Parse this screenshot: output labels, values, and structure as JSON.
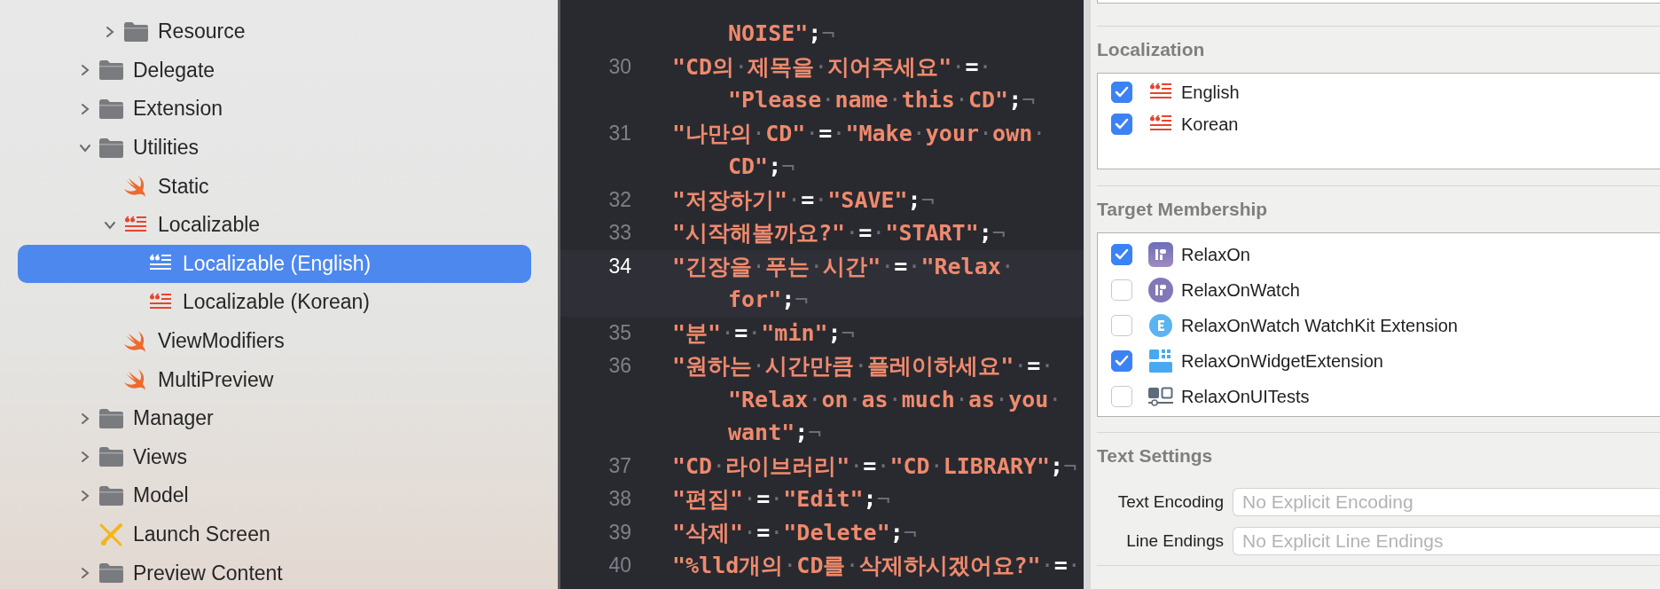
{
  "navigator": {
    "items": [
      {
        "children": [
          {
            "name": "Resource",
            "kind": "folder",
            "expanded": false
          }
        ]
      },
      {
        "name": "Delegate",
        "kind": "folder",
        "expanded": false
      },
      {
        "name": "Extension",
        "kind": "folder",
        "expanded": false
      },
      {
        "name": "Utilities",
        "kind": "folder",
        "expanded": true,
        "children": [
          {
            "name": "Static",
            "kind": "swift"
          },
          {
            "name": "Localizable",
            "kind": "strings",
            "expanded": true,
            "children": [
              {
                "name": "Localizable (English)",
                "kind": "strings",
                "selected": true
              },
              {
                "name": "Localizable (Korean)",
                "kind": "strings",
                "selected": false
              }
            ]
          },
          {
            "name": "ViewModifiers",
            "kind": "swift"
          },
          {
            "name": "MultiPreview",
            "kind": "swift"
          }
        ]
      },
      {
        "name": "Manager",
        "kind": "folder",
        "expanded": false
      },
      {
        "name": "Views",
        "kind": "folder",
        "expanded": false
      },
      {
        "name": "Model",
        "kind": "folder",
        "expanded": false
      },
      {
        "name": "Launch Screen",
        "kind": "storyboard"
      },
      {
        "name": "Preview Content",
        "kind": "folder",
        "expanded": false
      }
    ]
  },
  "editor": {
    "lines": [
      {
        "continuation": true,
        "current": false,
        "rows": [
          {
            "tokens": [
              {
                "kind": "string",
                "text": "NOISE\""
              },
              {
                "kind": "op",
                "text": ";"
              },
              {
                "kind": "eol",
                "text": "¬"
              }
            ]
          }
        ]
      },
      {
        "number": "30",
        "current": false,
        "rows": [
          {
            "tokens": [
              {
                "kind": "string",
                "text": "\"CD의"
              },
              {
                "kind": "space",
                "text": "·"
              },
              {
                "kind": "string",
                "text": "제목을"
              },
              {
                "kind": "space",
                "text": "·"
              },
              {
                "kind": "string",
                "text": "지어주세요\""
              },
              {
                "kind": "space",
                "text": "·"
              },
              {
                "kind": "op",
                "text": "="
              },
              {
                "kind": "space",
                "text": "·"
              }
            ]
          },
          {
            "tokens": [
              {
                "kind": "string",
                "text": "\"Please"
              },
              {
                "kind": "space",
                "text": "·"
              },
              {
                "kind": "string",
                "text": "name"
              },
              {
                "kind": "space",
                "text": "·"
              },
              {
                "kind": "string",
                "text": "this"
              },
              {
                "kind": "space",
                "text": "·"
              },
              {
                "kind": "string",
                "text": "CD\""
              },
              {
                "kind": "op",
                "text": ";"
              },
              {
                "kind": "eol",
                "text": "¬"
              }
            ]
          }
        ]
      },
      {
        "number": "31",
        "current": false,
        "rows": [
          {
            "tokens": [
              {
                "kind": "string",
                "text": "\"나만의"
              },
              {
                "kind": "space",
                "text": "·"
              },
              {
                "kind": "string",
                "text": "CD\""
              },
              {
                "kind": "space",
                "text": "·"
              },
              {
                "kind": "op",
                "text": "="
              },
              {
                "kind": "space",
                "text": "·"
              },
              {
                "kind": "string",
                "text": "\"Make"
              },
              {
                "kind": "space",
                "text": "·"
              },
              {
                "kind": "string",
                "text": "your"
              },
              {
                "kind": "space",
                "text": "·"
              },
              {
                "kind": "string",
                "text": "own"
              },
              {
                "kind": "space",
                "text": "·"
              }
            ]
          },
          {
            "tokens": [
              {
                "kind": "string",
                "text": "CD\""
              },
              {
                "kind": "op",
                "text": ";"
              },
              {
                "kind": "eol",
                "text": "¬"
              }
            ]
          }
        ]
      },
      {
        "number": "32",
        "current": false,
        "rows": [
          {
            "tokens": [
              {
                "kind": "string",
                "text": "\"저장하기\""
              },
              {
                "kind": "space",
                "text": "·"
              },
              {
                "kind": "op",
                "text": "="
              },
              {
                "kind": "space",
                "text": "·"
              },
              {
                "kind": "string",
                "text": "\"SAVE\""
              },
              {
                "kind": "op",
                "text": ";"
              },
              {
                "kind": "eol",
                "text": "¬"
              }
            ]
          }
        ]
      },
      {
        "number": "33",
        "current": false,
        "rows": [
          {
            "tokens": [
              {
                "kind": "string",
                "text": "\"시작해볼까요?\""
              },
              {
                "kind": "space",
                "text": "·"
              },
              {
                "kind": "op",
                "text": "="
              },
              {
                "kind": "space",
                "text": "·"
              },
              {
                "kind": "string",
                "text": "\"START\""
              },
              {
                "kind": "op",
                "text": ";"
              },
              {
                "kind": "eol",
                "text": "¬"
              }
            ]
          }
        ]
      },
      {
        "number": "34",
        "current": true,
        "rows": [
          {
            "tokens": [
              {
                "kind": "string",
                "text": "\"긴장을"
              },
              {
                "kind": "space",
                "text": "·"
              },
              {
                "kind": "string",
                "text": "푸는"
              },
              {
                "kind": "space",
                "text": "·"
              },
              {
                "kind": "string",
                "text": "시간\""
              },
              {
                "kind": "space",
                "text": "·"
              },
              {
                "kind": "op",
                "text": "="
              },
              {
                "kind": "space",
                "text": "·"
              },
              {
                "kind": "string",
                "text": "\"Relax"
              },
              {
                "kind": "space",
                "text": "·"
              }
            ]
          },
          {
            "tokens": [
              {
                "kind": "string",
                "text": "for\""
              },
              {
                "kind": "op",
                "text": ";"
              },
              {
                "kind": "eol",
                "text": "¬"
              }
            ]
          }
        ]
      },
      {
        "number": "35",
        "current": false,
        "rows": [
          {
            "tokens": [
              {
                "kind": "string",
                "text": "\"분\""
              },
              {
                "kind": "space",
                "text": "·"
              },
              {
                "kind": "op",
                "text": "="
              },
              {
                "kind": "space",
                "text": "·"
              },
              {
                "kind": "string",
                "text": "\"min\""
              },
              {
                "kind": "op",
                "text": ";"
              },
              {
                "kind": "eol",
                "text": "¬"
              }
            ]
          }
        ]
      },
      {
        "number": "36",
        "current": false,
        "rows": [
          {
            "tokens": [
              {
                "kind": "string",
                "text": "\"원하는"
              },
              {
                "kind": "space",
                "text": "·"
              },
              {
                "kind": "string",
                "text": "시간만큼"
              },
              {
                "kind": "space",
                "text": "·"
              },
              {
                "kind": "string",
                "text": "플레이하세요\""
              },
              {
                "kind": "space",
                "text": "·"
              },
              {
                "kind": "op",
                "text": "="
              },
              {
                "kind": "space",
                "text": "·"
              }
            ]
          },
          {
            "tokens": [
              {
                "kind": "string",
                "text": "\"Relax"
              },
              {
                "kind": "space",
                "text": "·"
              },
              {
                "kind": "string",
                "text": "on"
              },
              {
                "kind": "space",
                "text": "·"
              },
              {
                "kind": "string",
                "text": "as"
              },
              {
                "kind": "space",
                "text": "·"
              },
              {
                "kind": "string",
                "text": "much"
              },
              {
                "kind": "space",
                "text": "·"
              },
              {
                "kind": "string",
                "text": "as"
              },
              {
                "kind": "space",
                "text": "·"
              },
              {
                "kind": "string",
                "text": "you"
              },
              {
                "kind": "space",
                "text": "·"
              }
            ]
          },
          {
            "tokens": [
              {
                "kind": "string",
                "text": "want\""
              },
              {
                "kind": "op",
                "text": ";"
              },
              {
                "kind": "eol",
                "text": "¬"
              }
            ]
          }
        ]
      },
      {
        "number": "37",
        "current": false,
        "rows": [
          {
            "tokens": [
              {
                "kind": "string",
                "text": "\"CD"
              },
              {
                "kind": "space",
                "text": "·"
              },
              {
                "kind": "string",
                "text": "라이브러리\""
              },
              {
                "kind": "space",
                "text": "·"
              },
              {
                "kind": "op",
                "text": "="
              },
              {
                "kind": "space",
                "text": "·"
              },
              {
                "kind": "string",
                "text": "\"CD"
              },
              {
                "kind": "space",
                "text": "·"
              },
              {
                "kind": "string",
                "text": "LIBRARY\""
              },
              {
                "kind": "op",
                "text": ";"
              },
              {
                "kind": "eol",
                "text": "¬"
              }
            ]
          }
        ]
      },
      {
        "number": "38",
        "current": false,
        "rows": [
          {
            "tokens": [
              {
                "kind": "string",
                "text": "\"편집\""
              },
              {
                "kind": "space",
                "text": "·"
              },
              {
                "kind": "op",
                "text": "="
              },
              {
                "kind": "space",
                "text": "·"
              },
              {
                "kind": "string",
                "text": "\"Edit\""
              },
              {
                "kind": "op",
                "text": ";"
              },
              {
                "kind": "eol",
                "text": "¬"
              }
            ]
          }
        ]
      },
      {
        "number": "39",
        "current": false,
        "rows": [
          {
            "tokens": [
              {
                "kind": "string",
                "text": "\"삭제\""
              },
              {
                "kind": "space",
                "text": "·"
              },
              {
                "kind": "op",
                "text": "="
              },
              {
                "kind": "space",
                "text": "·"
              },
              {
                "kind": "string",
                "text": "\"Delete\""
              },
              {
                "kind": "op",
                "text": ";"
              },
              {
                "kind": "eol",
                "text": "¬"
              }
            ]
          }
        ]
      },
      {
        "number": "40",
        "current": false,
        "rows": [
          {
            "tokens": [
              {
                "kind": "string",
                "text": "\"%lld개의"
              },
              {
                "kind": "space",
                "text": "·"
              },
              {
                "kind": "string",
                "text": "CD를"
              },
              {
                "kind": "space",
                "text": "·"
              },
              {
                "kind": "string",
                "text": "삭제하시겠어요?\""
              },
              {
                "kind": "space",
                "text": "·"
              },
              {
                "kind": "op",
                "text": "="
              },
              {
                "kind": "space",
                "text": "·"
              }
            ]
          }
        ]
      }
    ]
  },
  "inspector": {
    "localization": {
      "title": "Localization",
      "items": [
        {
          "label": "English",
          "checked": true
        },
        {
          "label": "Korean",
          "checked": true
        }
      ]
    },
    "target_membership": {
      "title": "Target Membership",
      "items": [
        {
          "label": "RelaxOn",
          "kind": "app",
          "checked": true
        },
        {
          "label": "RelaxOnWatch",
          "kind": "watch-app",
          "checked": false
        },
        {
          "label": "RelaxOnWatch WatchKit Extension",
          "kind": "extension",
          "checked": false
        },
        {
          "label": "RelaxOnWidgetExtension",
          "kind": "widget",
          "checked": true
        },
        {
          "label": "RelaxOnUITests",
          "kind": "ui-tests",
          "checked": false
        }
      ]
    },
    "text_settings": {
      "title": "Text Settings",
      "fields": [
        {
          "label": "Text Encoding",
          "placeholder": "No Explicit Encoding"
        },
        {
          "label": "Line Endings",
          "placeholder": "No Explicit Line Endings"
        }
      ]
    }
  }
}
